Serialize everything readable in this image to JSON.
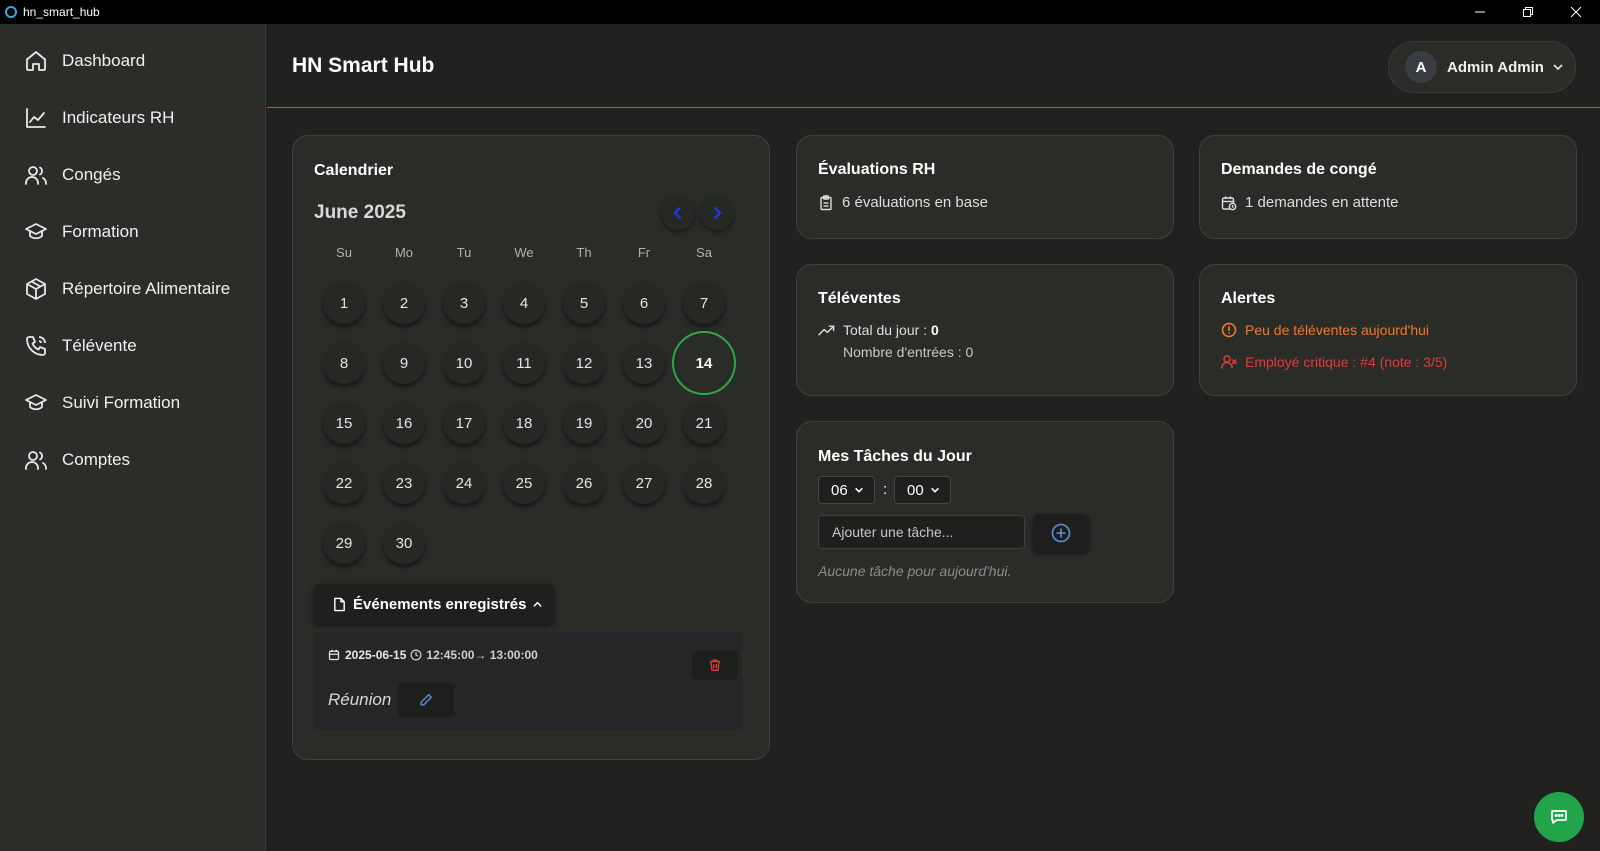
{
  "window": {
    "title": "hn_smart_hub"
  },
  "sidebar": {
    "items": [
      {
        "label": "Dashboard",
        "icon": "home-icon"
      },
      {
        "label": "Indicateurs RH",
        "icon": "chart-line-icon"
      },
      {
        "label": "Congés",
        "icon": "users-icon"
      },
      {
        "label": "Formation",
        "icon": "graduation-cap-icon"
      },
      {
        "label": "Répertoire Alimentaire",
        "icon": "box-icon"
      },
      {
        "label": "Télévente",
        "icon": "phone-icon"
      },
      {
        "label": "Suivi Formation",
        "icon": "graduation-cap-icon"
      },
      {
        "label": "Comptes",
        "icon": "users-icon"
      }
    ]
  },
  "header": {
    "title": "HN Smart Hub",
    "user": {
      "initial": "A",
      "name": "Admin Admin"
    }
  },
  "calendar": {
    "title": "Calendrier",
    "month_label": "June 2025",
    "weekdays": [
      "Su",
      "Mo",
      "Tu",
      "We",
      "Th",
      "Fr",
      "Sa"
    ],
    "days": [
      "1",
      "2",
      "3",
      "4",
      "5",
      "6",
      "7",
      "8",
      "9",
      "10",
      "11",
      "12",
      "13",
      "14",
      "15",
      "16",
      "17",
      "18",
      "19",
      "20",
      "21",
      "22",
      "23",
      "24",
      "25",
      "26",
      "27",
      "28",
      "29",
      "30"
    ],
    "today": "14",
    "events_toggle_label": "Événements enregistrés",
    "events": [
      {
        "date": "2025-06-15",
        "time": "12:45:00→ 13:00:00",
        "name": "Réunion"
      }
    ]
  },
  "evaluations": {
    "title": "Évaluations RH",
    "summary": "6 évaluations en base"
  },
  "leave_requests": {
    "title": "Demandes de congé",
    "summary": "1 demandes en attente"
  },
  "televentes": {
    "title": "Téléventes",
    "total_label": "Total du jour : ",
    "total_value": "0",
    "entries_text": "Nombre d'entrées : 0"
  },
  "alerts": {
    "title": "Alertes",
    "items": [
      {
        "text": "Peu de téléventes aujourd'hui",
        "level": "warning",
        "color": "#f0782e"
      },
      {
        "text": "Employé critique : #4 (note : 3/5)",
        "level": "critical",
        "color": "#e03a3a"
      }
    ]
  },
  "tasks": {
    "title": "Mes Tâches du Jour",
    "hour": "06",
    "minute": "00",
    "separator": ":",
    "input_placeholder": "Ajouter une tâche...",
    "empty_text": "Aucune tâche pour aujourd'hui."
  },
  "colors": {
    "accent_green": "#2fa84a",
    "nav_blue": "#2233dd",
    "danger_red": "#e03a3a",
    "warning_orange": "#f0782e",
    "icon_blue": "#5b8fe0"
  }
}
